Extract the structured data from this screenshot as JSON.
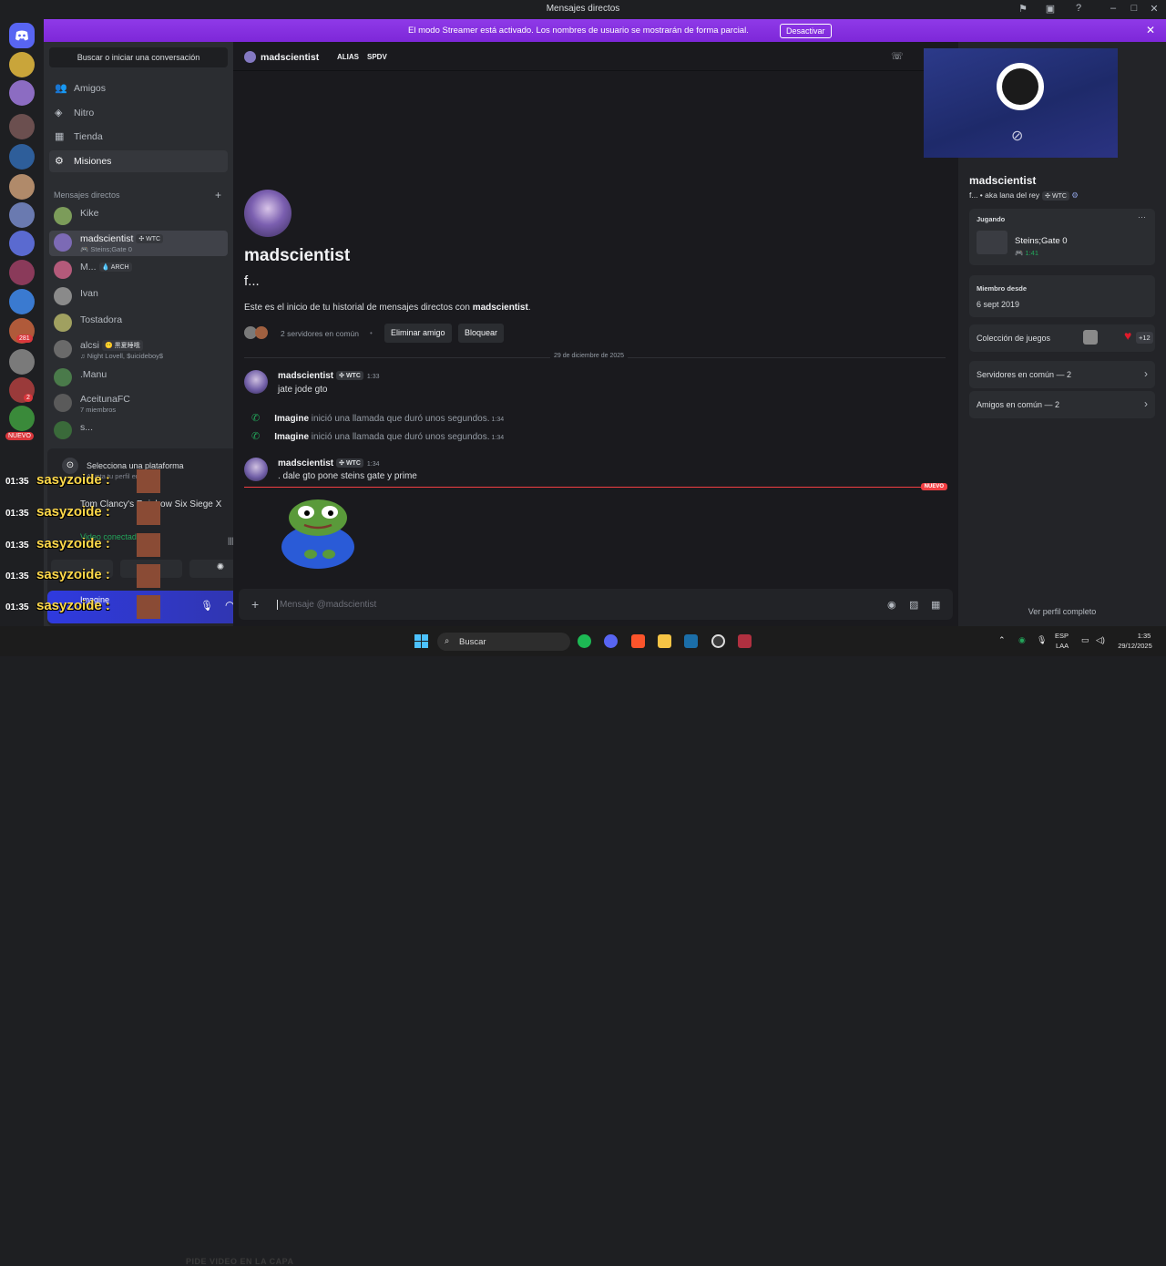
{
  "window": {
    "title": "Mensajes directos",
    "controls": [
      "⚑",
      "▣",
      "?",
      "–",
      "□",
      "✕"
    ]
  },
  "banner": {
    "text": "El modo Streamer está activado. Los nombres de usuario se mostrarán de forma parcial.",
    "button": "Desactivar",
    "close": "✕"
  },
  "server_rail": {
    "badges": {
      "b1": "281",
      "b2": "2"
    },
    "new_label": "NUEVO"
  },
  "sidebar": {
    "search": "Buscar o iniciar una conversación",
    "nav": [
      {
        "label": "Amigos",
        "icon": "👥"
      },
      {
        "label": "Nitro",
        "icon": "◈"
      },
      {
        "label": "Tienda",
        "icon": "▦"
      },
      {
        "label": "Misiones",
        "icon": "⚙"
      }
    ],
    "dm_header": "Mensajes directos",
    "dm_add": "+",
    "dms": [
      {
        "name": "Kike",
        "tag": "",
        "sub": "",
        "color": "#7c9c5a"
      },
      {
        "name": "madscientist",
        "tag": "✣ WTC",
        "sub": "🎮 Steins;Gate 0",
        "color": "#7c6ab5"
      },
      {
        "name": "M...",
        "tag": "💧 ARCH",
        "sub": "",
        "color": "#b45a7a"
      },
      {
        "name": "Ivan",
        "tag": "",
        "sub": "",
        "color": "#8a8a8a"
      },
      {
        "name": "Tostadora",
        "tag": "",
        "sub": "",
        "color": "#a0a060"
      },
      {
        "name": "alcsi",
        "tag": "😶 黒夏睡哦",
        "sub": "♫ Night Lovell, $uicideboy$",
        "color": "#6a6a6a"
      },
      {
        "name": ".Manu",
        "tag": "",
        "sub": "",
        "color": "#4a7a4a"
      },
      {
        "name": "AceitunaFC",
        "tag": "",
        "sub": "7 miembros",
        "color": "#5a5a5a"
      },
      {
        "name": "s...",
        "tag": "",
        "sub": "",
        "color": "#3a6a3a"
      }
    ],
    "panel": {
      "platform": "Selecciona una plataforma",
      "platform_sub": "Ajusta tu perfil en esta...",
      "game": "Tom Clancy's Rainbow Six Siege X",
      "video": "Video conectado",
      "overlay_user": "sasyzoide :",
      "overlay_time": "01:35"
    },
    "user": {
      "name": "Imagine"
    }
  },
  "chat": {
    "header": {
      "name": "madscientist",
      "tab1": "ALIAS",
      "tab2": "SPDV"
    },
    "profile": {
      "name": "madscientist",
      "status": "f...",
      "intro_pre": "Este es el inicio de tu historial de mensajes directos con ",
      "intro_name": "madscientist",
      "intro_end": ".",
      "mutual": "2 servidores en común",
      "dot": "•",
      "btn_remove": "Eliminar amigo",
      "btn_block": "Bloquear"
    },
    "date": "29 de diciembre de 2025",
    "messages": [
      {
        "author": "madscientist",
        "tag": "✣ WTC",
        "time": "1:33",
        "text": "jate jode gto"
      },
      {
        "author": "madscientist",
        "tag": "✣ WTC",
        "time": "1:34",
        "text": ". dale gto pone steins gate y prime"
      }
    ],
    "calls": [
      {
        "user": "Imagine",
        "text": "inició una llamada que duró unos segundos.",
        "time": "1:34"
      },
      {
        "user": "Imagine",
        "text": "inició una llamada que duró unos segundos.",
        "time": "1:34"
      }
    ],
    "new_label": "NUEVO",
    "composer_placeholder": "Mensaje @madscientist"
  },
  "profile_panel": {
    "name": "madscientist",
    "sub": "f... • aka lana del rey",
    "tag": "✣ WTC",
    "playing_title": "Jugando",
    "game_name": "Steins;Gate 0",
    "game_time": "🎮 1:41",
    "member_since_title": "Miembro desde",
    "member_since": "6 sept 2019",
    "games_collection": "Colección de juegos",
    "games_more": "+12",
    "mutual_servers": "Servidores en común — 2",
    "mutual_friends": "Amigos en común — 2",
    "full_profile": "Ver perfil completo"
  },
  "taskbar": {
    "search": "Buscar",
    "lang": "ESP",
    "lang2": "LAA",
    "time": "1:35",
    "date": "29/12/2025",
    "ghost": "PIDE VIDEO EN LA CAPA"
  }
}
